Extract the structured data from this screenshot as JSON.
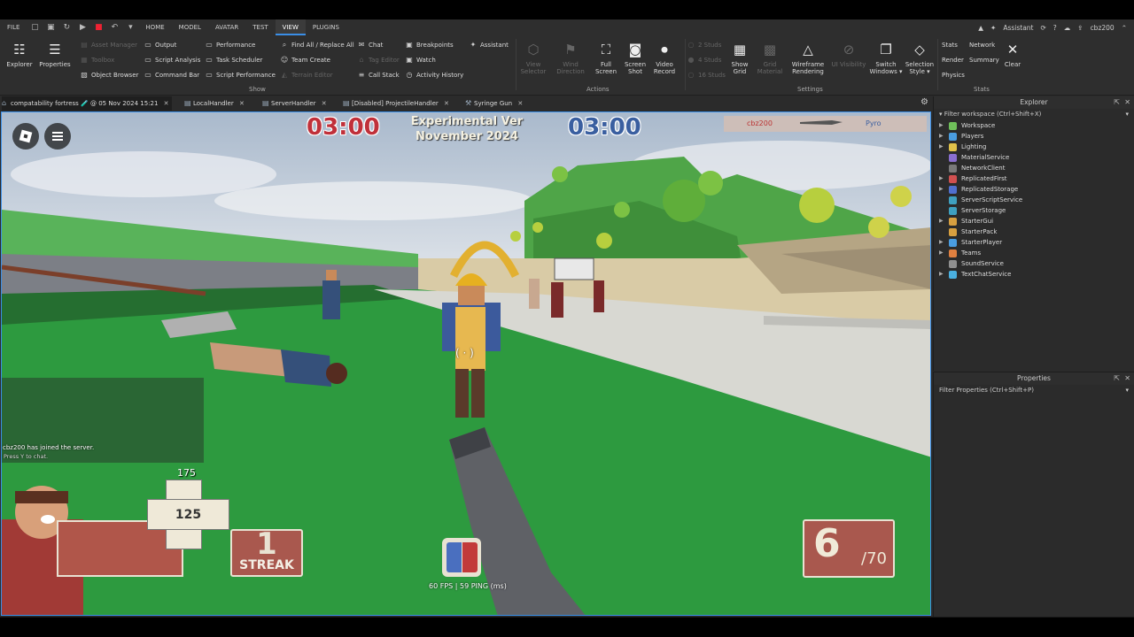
{
  "menubar": {
    "items": [
      {
        "label": "FILE",
        "active": false
      },
      {
        "label": "HOME",
        "active": false
      },
      {
        "label": "MODEL",
        "active": false
      },
      {
        "label": "AVATAR",
        "active": false
      },
      {
        "label": "TEST",
        "active": false
      },
      {
        "label": "VIEW",
        "active": true
      },
      {
        "label": "PLUGINS",
        "active": false
      }
    ],
    "assistant_label": "Assistant",
    "username": "cbz200"
  },
  "ribbon": {
    "explorer": "Explorer",
    "properties": "Properties",
    "col1": [
      "Asset Manager",
      "Toolbox",
      "Object Browser"
    ],
    "col2": [
      "Output",
      "Script Analysis",
      "Command Bar"
    ],
    "col3": [
      "Performance",
      "Task Scheduler",
      "Script Performance"
    ],
    "col4": [
      "Find All / Replace All",
      "Team Create",
      "Terrain Editor"
    ],
    "col5": [
      "Chat",
      "Tag Editor",
      "Call Stack"
    ],
    "col6": [
      "Breakpoints",
      "Watch",
      "Activity History"
    ],
    "col7": "Assistant",
    "show_label": "Show",
    "actions": [
      {
        "line1": "View",
        "line2": "Selector",
        "dim": true
      },
      {
        "line1": "Wind",
        "line2": "Direction",
        "dim": true
      },
      {
        "line1": "Full",
        "line2": "Screen",
        "dim": false
      },
      {
        "line1": "Screen",
        "line2": "Shot",
        "dim": false
      },
      {
        "line1": "Video",
        "line2": "Record",
        "dim": false
      }
    ],
    "actions_label": "Actions",
    "studs": [
      "2 Studs",
      "4 Studs",
      "16 Studs"
    ],
    "settings_btns": [
      {
        "line1": "Show",
        "line2": "Grid",
        "dim": false
      },
      {
        "line1": "Grid",
        "line2": "Material",
        "dim": true
      },
      {
        "line1": "Wireframe",
        "line2": "Rendering",
        "dim": false
      },
      {
        "line1": "UI Visibility",
        "line2": "",
        "dim": true
      },
      {
        "line1": "Switch",
        "line2": "Windows ▾",
        "dim": false
      },
      {
        "line1": "Selection",
        "line2": "Style ▾",
        "dim": false
      }
    ],
    "settings_label": "Settings",
    "stats": [
      "Stats",
      "Network",
      "Render",
      "Summary",
      "Physics"
    ],
    "clear": "Clear",
    "stats_label": "Stats"
  },
  "tabs": [
    {
      "label": "compatability fortress 🧪 @ 05 Nov 2024 15:21",
      "active": true
    },
    {
      "label": "LocalHandler",
      "active": false
    },
    {
      "label": "ServerHandler",
      "active": false
    },
    {
      "label": "[Disabled] ProjectileHandler",
      "active": false
    },
    {
      "label": "Syringe Gun",
      "active": false
    }
  ],
  "game": {
    "timer_red": "03:00",
    "timer_blu": "03:00",
    "version_line1": "Experimental Ver",
    "version_line2": "November 2024",
    "killfeed_killer": "cbz200",
    "killfeed_victim": "Pyro",
    "chat_message": "cbz200 has joined the server.",
    "chat_hint": "Press Y to chat.",
    "max_health": "175",
    "health": "125",
    "streak_number": "1",
    "streak_label": "STREAK",
    "ammo_clip": "6",
    "ammo_reserve": "/70",
    "fps_ping": "60 FPS | 59 PING (ms)",
    "crosshair": "( · )"
  },
  "explorer": {
    "title": "Explorer",
    "filter": "Filter workspace (Ctrl+Shift+X)",
    "items": [
      {
        "label": "Workspace",
        "expandable": true,
        "color": "#6fbf5a"
      },
      {
        "label": "Players",
        "expandable": true,
        "color": "#4a9de0"
      },
      {
        "label": "Lighting",
        "expandable": true,
        "color": "#e0c24a"
      },
      {
        "label": "MaterialService",
        "expandable": false,
        "color": "#8a6fd0"
      },
      {
        "label": "NetworkClient",
        "expandable": false,
        "color": "#7a7a7a"
      },
      {
        "label": "ReplicatedFirst",
        "expandable": true,
        "color": "#d05050"
      },
      {
        "label": "ReplicatedStorage",
        "expandable": true,
        "color": "#5070d0"
      },
      {
        "label": "ServerScriptService",
        "expandable": false,
        "color": "#3fa0c0"
      },
      {
        "label": "ServerStorage",
        "expandable": false,
        "color": "#3fa0c0"
      },
      {
        "label": "StarterGui",
        "expandable": true,
        "color": "#d8a040"
      },
      {
        "label": "StarterPack",
        "expandable": false,
        "color": "#d8a040"
      },
      {
        "label": "StarterPlayer",
        "expandable": true,
        "color": "#4a9de0"
      },
      {
        "label": "Teams",
        "expandable": true,
        "color": "#e08040"
      },
      {
        "label": "SoundService",
        "expandable": false,
        "color": "#909090"
      },
      {
        "label": "TextChatService",
        "expandable": true,
        "color": "#4ab0e0"
      }
    ]
  },
  "properties": {
    "title": "Properties",
    "filter": "Filter Properties (Ctrl+Shift+P)"
  },
  "colors": {
    "accent": "#3a8ee6",
    "red_team": "#c0303a",
    "blu_team": "#3a5fa0",
    "hud_panel": "#a9584e"
  }
}
